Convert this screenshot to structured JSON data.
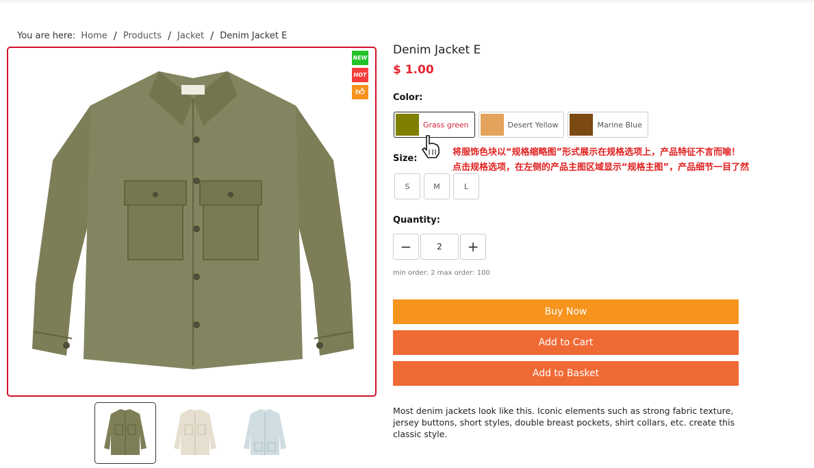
{
  "breadcrumb": {
    "prefix": "You are here:",
    "items": [
      "Home",
      "Products",
      "Jacket",
      "Denim Jacket E"
    ],
    "separator": "/"
  },
  "product": {
    "title": "Denim Jacket E",
    "price": "$ 1.00",
    "badges": {
      "new": "NEW",
      "hot": "HOT",
      "like_icon": "thumbs-up-icon"
    },
    "thumbnails": [
      {
        "name": "olive-jacket",
        "color": "#7e7f57",
        "active": true
      },
      {
        "name": "cream-jacket",
        "color": "#e6dfd0",
        "active": false
      },
      {
        "name": "light-blue-jacket",
        "color": "#cfdde0",
        "active": false
      }
    ]
  },
  "color": {
    "label": "Color:",
    "options": [
      {
        "name": "Grass green",
        "swatch": "#7f8000",
        "selected": true
      },
      {
        "name": "Desert Yellow",
        "swatch": "#e4a35c",
        "selected": false
      },
      {
        "name": "Marine Blue",
        "swatch": "#7b4a12",
        "selected": false
      }
    ]
  },
  "annotation": {
    "line1": "将服饰色块以“规格缩略图”形式展示在规格选项上，产品特征不言而喻！",
    "line2": "点击规格选项，在左侧的产品主图区域显示“规格主图”，产品细节一目了然"
  },
  "size": {
    "label": "Size:",
    "options": [
      "S",
      "M",
      "L"
    ]
  },
  "quantity": {
    "label": "Quantity:",
    "value": "2",
    "minus": "−",
    "plus": "+",
    "note": "min order: 2 max order: 100"
  },
  "buttons": {
    "buy_now": "Buy Now",
    "add_to_cart": "Add to Cart",
    "add_to_basket": "Add to Basket"
  },
  "description": "Most denim jackets look like this. Iconic elements such as strong fabric texture, jersey buttons, short styles, double breast pockets, shirt collars, etc. create this classic style.",
  "colors": {
    "accent_red": "#e52430",
    "buy_orange": "#f7941d",
    "cart_orange": "#f06a35",
    "frame_red": "#d0102a"
  }
}
